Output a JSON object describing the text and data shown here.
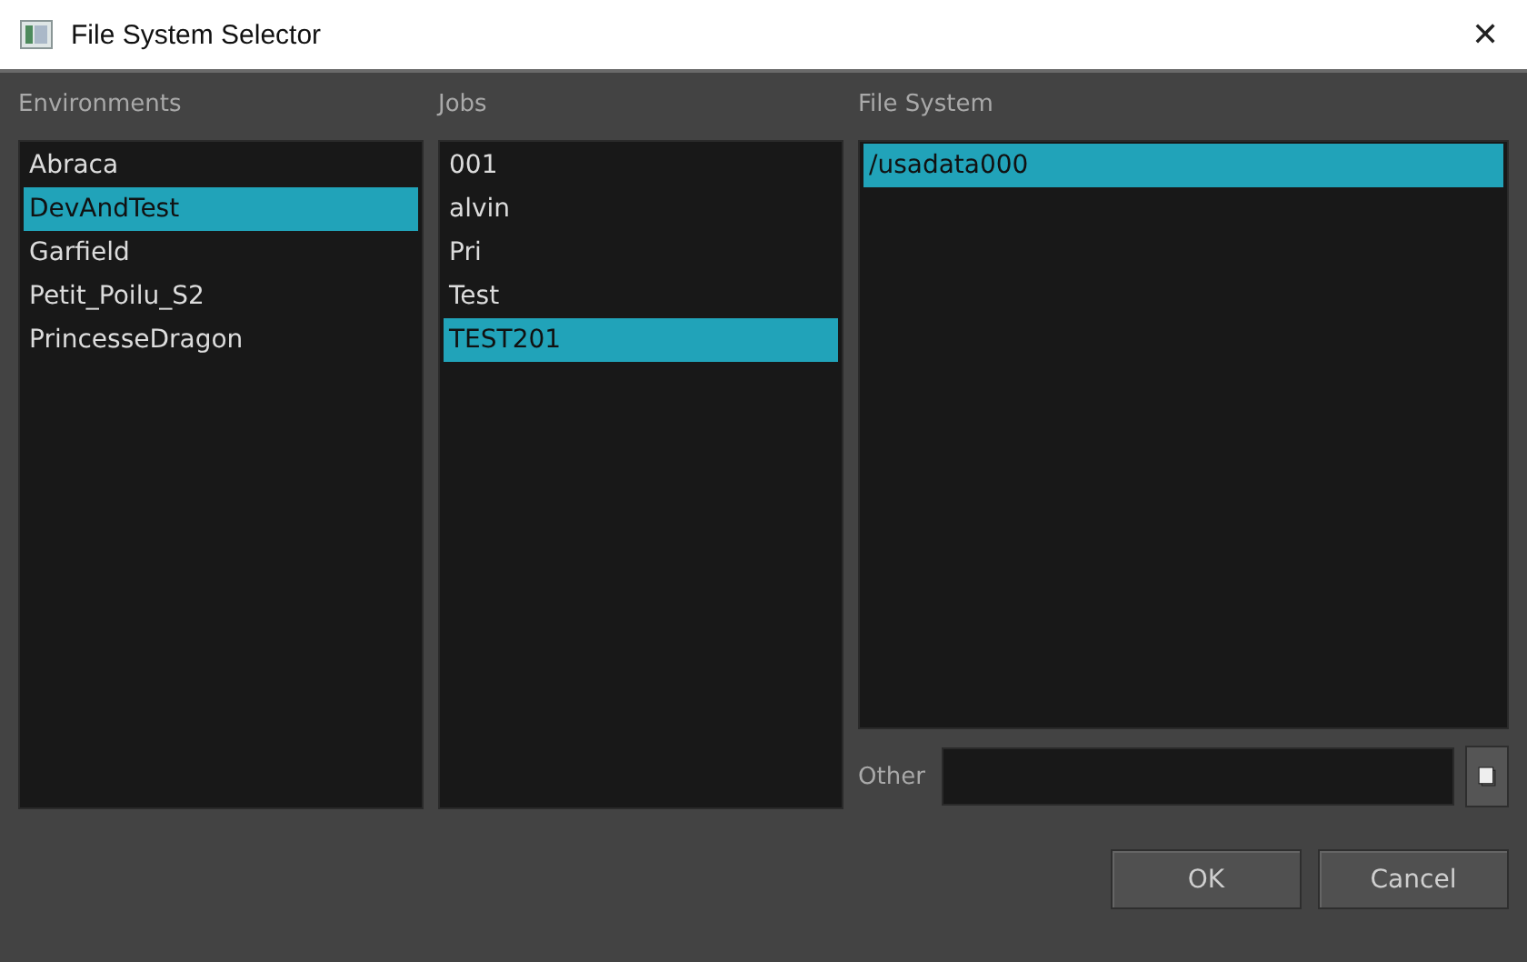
{
  "window": {
    "title": "File System Selector",
    "close": "✕"
  },
  "environments": {
    "label": "Environments",
    "items": [
      {
        "text": "Abraca",
        "selected": false
      },
      {
        "text": "DevAndTest",
        "selected": true
      },
      {
        "text": "Garfield",
        "selected": false
      },
      {
        "text": "Petit_Poilu_S2",
        "selected": false
      },
      {
        "text": "PrincesseDragon",
        "selected": false
      }
    ]
  },
  "jobs": {
    "label": "Jobs",
    "items": [
      {
        "text": "001",
        "selected": false
      },
      {
        "text": "alvin",
        "selected": false
      },
      {
        "text": "Pri",
        "selected": false
      },
      {
        "text": "Test",
        "selected": false
      },
      {
        "text": "TEST201",
        "selected": true
      }
    ]
  },
  "file_system": {
    "label": "File System",
    "items": [
      {
        "text": "/usadata000",
        "selected": true
      }
    ]
  },
  "other": {
    "label": "Other"
  },
  "buttons": [
    "OK",
    "Cancel"
  ]
}
